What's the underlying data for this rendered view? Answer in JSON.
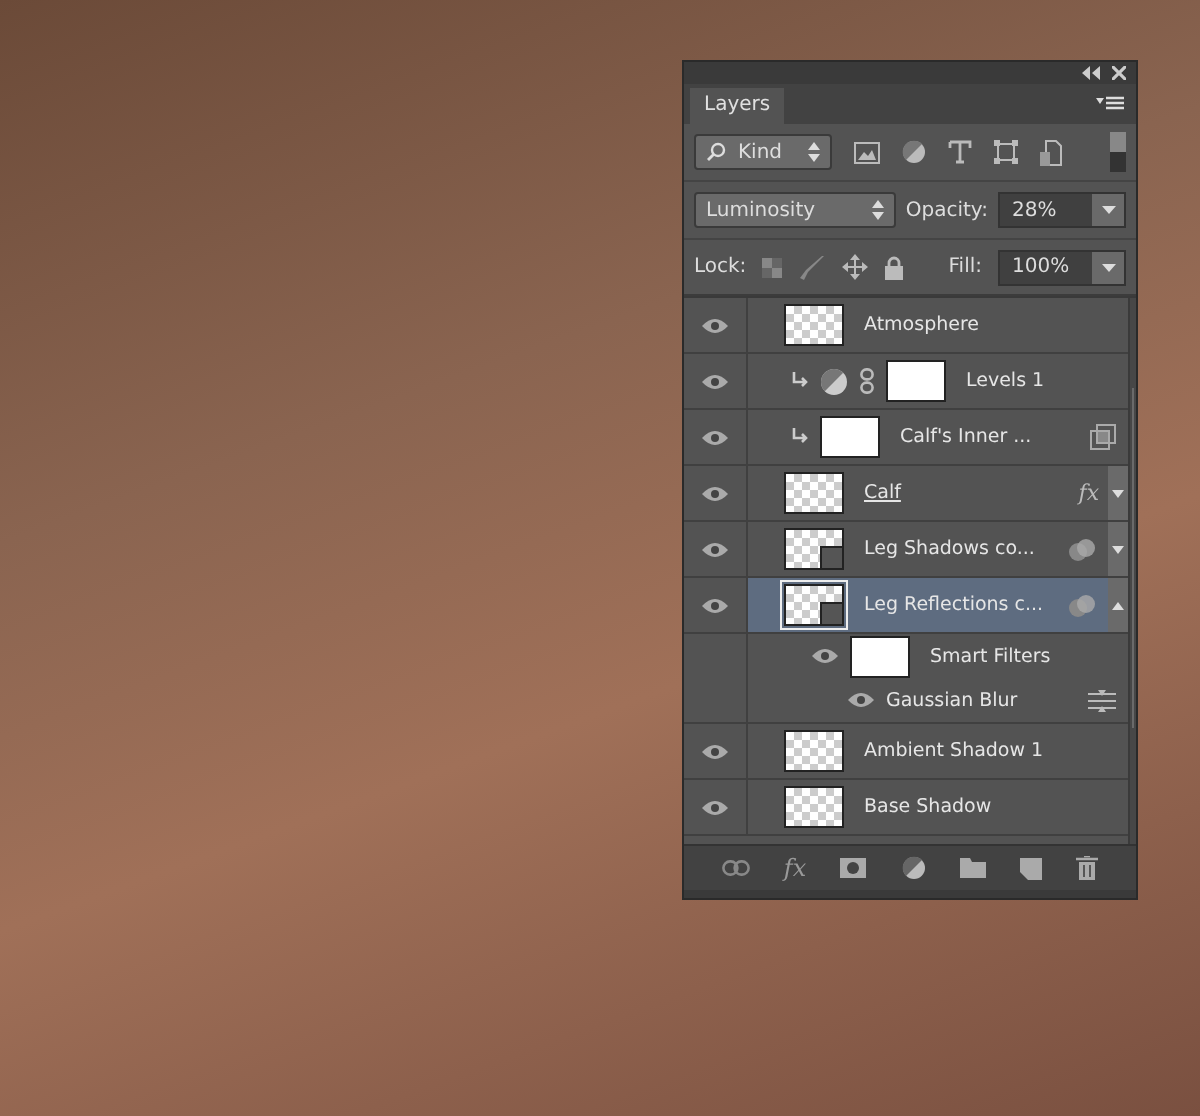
{
  "panel": {
    "tab": "Layers",
    "filter": "Kind",
    "blend_mode": "Luminosity",
    "opacity_label": "Opacity:",
    "opacity": "28%",
    "lock_label": "Lock:",
    "fill_label": "Fill:",
    "fill": "100%",
    "footer_fx": "fx"
  },
  "layers": [
    {
      "kind": "pixel",
      "name": "Atmosphere",
      "visible": true,
      "selected": false,
      "clipped": false
    },
    {
      "kind": "adjustment",
      "name": "Levels 1",
      "visible": true,
      "selected": false,
      "clipped": true
    },
    {
      "kind": "mask",
      "name": "Calf's Inner ...",
      "visible": true,
      "selected": false,
      "clipped": true,
      "trailing": {
        "kind": "squares"
      }
    },
    {
      "kind": "pixel",
      "name": "Calf",
      "visible": true,
      "selected": false,
      "clipped": false,
      "underlined": true,
      "effects_mark": "fx",
      "expanded": false
    },
    {
      "kind": "smart",
      "name": "Leg Shadows co...",
      "visible": true,
      "selected": false,
      "clipped": false,
      "trailing": {
        "kind": "circles"
      },
      "expanded": false
    },
    {
      "kind": "smart",
      "name": "Leg Reflections c...",
      "visible": true,
      "selected": true,
      "clipped": false,
      "trailing": {
        "kind": "circles"
      },
      "expanded": true
    },
    {
      "kind": "filter_group",
      "name": "Smart Filters",
      "visible": true,
      "selected": false,
      "clipped": false
    },
    {
      "kind": "filter",
      "name": "Gaussian Blur",
      "visible": true,
      "selected": false,
      "clipped": false,
      "trailing": {
        "kind": "sliders"
      }
    },
    {
      "kind": "pixel",
      "name": "Ambient Shadow 1",
      "visible": true,
      "selected": false,
      "clipped": false
    },
    {
      "kind": "pixel",
      "name": "Base Shadow",
      "visible": true,
      "selected": false,
      "clipped": false
    }
  ]
}
